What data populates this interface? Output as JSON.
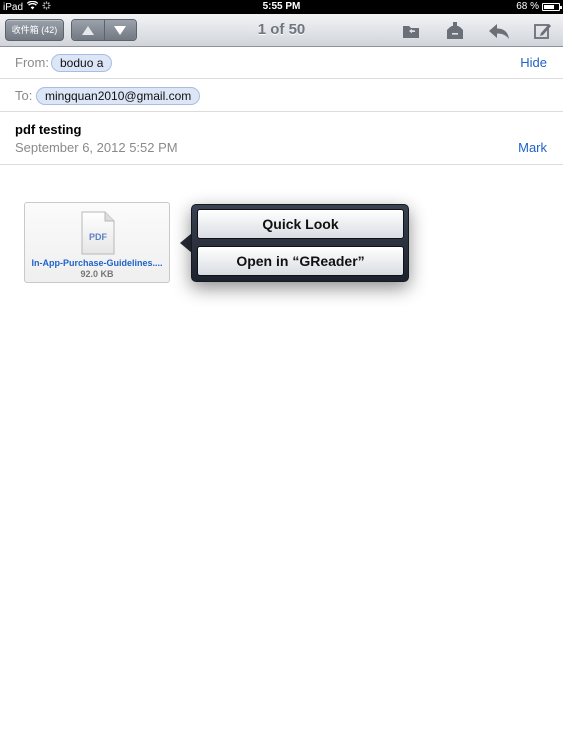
{
  "status_bar": {
    "device": "iPad",
    "time": "5:55 PM",
    "battery": "68 %",
    "battery_level": 0.68
  },
  "toolbar": {
    "inbox_label": "收件箱 (42)",
    "message_position": "1 of 50"
  },
  "header": {
    "from_label": "From:",
    "from_value": "boduo a",
    "hide_label": "Hide",
    "to_label": "To:",
    "to_value": "mingquan2010@gmail.com"
  },
  "message": {
    "subject": "pdf testing",
    "date": "September 6, 2012 5:52 PM",
    "mark_label": "Mark"
  },
  "attachment": {
    "icon_text": "PDF",
    "name": "In-App-Purchase-Guidelines....",
    "size": "92.0 KB"
  },
  "popover": {
    "quick_look": "Quick Look",
    "open_in": "Open in “GReader”"
  }
}
